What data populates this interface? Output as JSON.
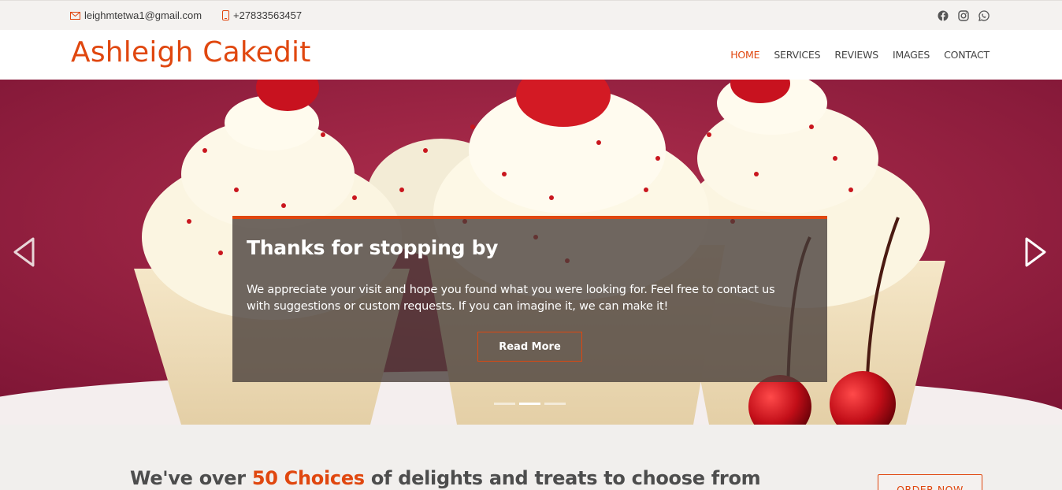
{
  "topbar": {
    "email": "leighmtetwa1@gmail.com",
    "phone": "+27833563457",
    "socials": [
      "facebook-icon",
      "instagram-icon",
      "whatsapp-icon"
    ]
  },
  "header": {
    "brand": "Ashleigh Cakedit",
    "nav": [
      {
        "label": "HOME",
        "active": true
      },
      {
        "label": "SERVICES",
        "active": false
      },
      {
        "label": "REVIEWS",
        "active": false
      },
      {
        "label": "IMAGES",
        "active": false
      },
      {
        "label": "CONTACT",
        "active": false
      }
    ]
  },
  "hero": {
    "title": "Thanks for stopping by",
    "text": "We appreciate your visit and hope you found what you were looking for. Feel free to contact us with suggestions or custom requests. If you can imagine it, we can make it!",
    "button": "Read More",
    "slides": 3,
    "active_slide": 2
  },
  "callout": {
    "prefix": "We've over ",
    "highlight": "50 Choices",
    "suffix": " of delights and treats to choose from",
    "button": "ORDER NOW"
  },
  "colors": {
    "accent": "#e0470f",
    "text": "#444444",
    "background": "#f1efed"
  }
}
